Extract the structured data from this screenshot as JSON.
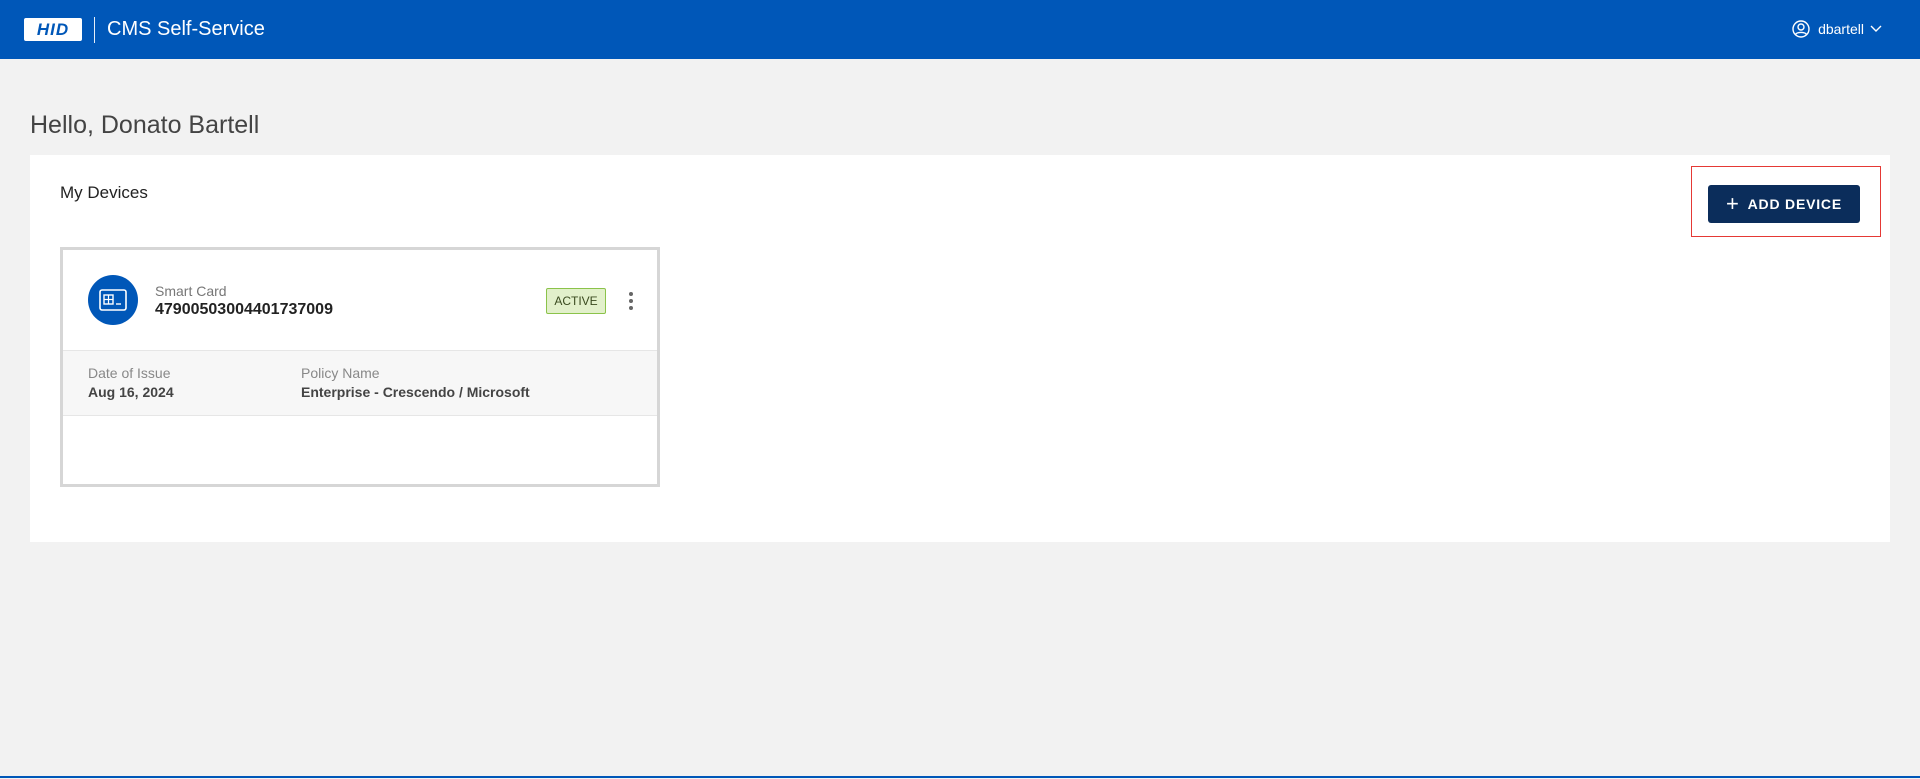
{
  "header": {
    "logo_text": "HID",
    "app_title": "CMS Self-Service",
    "user": {
      "username": "dbartell",
      "icon": "user-circle-icon",
      "chevron": "chevron-down-icon"
    }
  },
  "greeting": "Hello, Donato Bartell",
  "devices_panel": {
    "title": "My Devices",
    "add_button": {
      "label": "ADD DEVICE",
      "icon": "plus-icon"
    },
    "devices": [
      {
        "icon": "smart-card-icon",
        "type": "Smart Card",
        "id": "47900503004401737009",
        "status": "ACTIVE",
        "details": {
          "date_label": "Date of Issue",
          "date_value": "Aug 16, 2024",
          "policy_label": "Policy Name",
          "policy_value": "Enterprise - Crescendo / Microsoft"
        }
      }
    ]
  },
  "colors": {
    "brand_blue": "#0057b8",
    "button_navy": "#0b2d5b",
    "active_badge_bg": "#e2f0cb",
    "active_badge_border": "#8bc34a",
    "highlight_red": "#e53935"
  }
}
